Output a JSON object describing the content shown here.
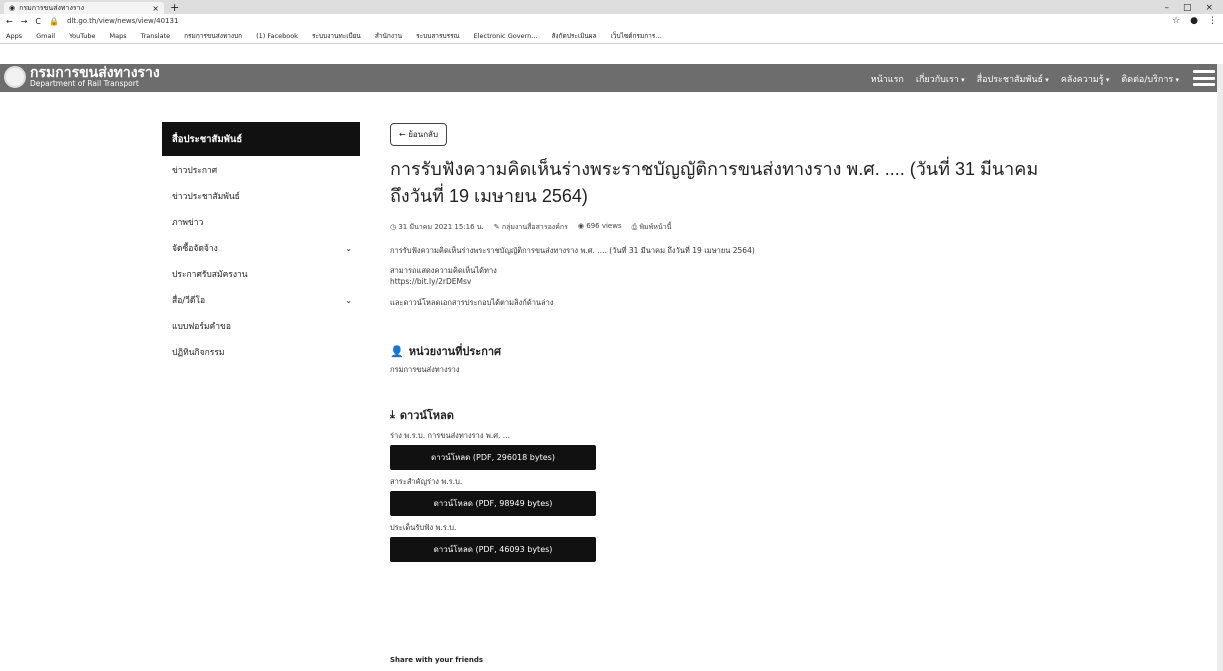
{
  "browser": {
    "tab_title": "กรมการขนส่งทางราง",
    "url": "dlt.go.th/view/news/view/40131",
    "bookmarks": [
      "Apps",
      "Gmail",
      "YouTube",
      "Maps",
      "Translate",
      "กรมการขนส่งทางบก",
      "(1) Facebook",
      "ระบบงานทะเบียน",
      "สำนักงาน",
      "ระบบสารบรรณ",
      "Electronic Govern...",
      "สังกัดประเมินผล",
      "เว็บไซต์กรมการ..."
    ]
  },
  "header": {
    "logo_th": "กรมการขนส่งทางราง",
    "logo_en": "Department of Rail Transport",
    "nav": [
      "หน้าแรก",
      "เกี่ยวกับเรา",
      "สื่อประชาสัมพันธ์",
      "คลังความรู้",
      "ติดต่อ/บริการ"
    ]
  },
  "sidebar": {
    "heading": "สื่อประชาสัมพันธ์",
    "items": [
      {
        "label": "ข่าวประกาศ",
        "chevron": false
      },
      {
        "label": "ข่าวประชาสัมพันธ์",
        "chevron": false
      },
      {
        "label": "ภาพข่าว",
        "chevron": false
      },
      {
        "label": "จัดซื้อจัดจ้าง",
        "chevron": true
      },
      {
        "label": "ประกาศรับสมัครงาน",
        "chevron": false
      },
      {
        "label": "สื่อ/วีดีโอ",
        "chevron": true
      },
      {
        "label": "แบบฟอร์มคำขอ",
        "chevron": false
      },
      {
        "label": "ปฏิทินกิจกรรม",
        "chevron": false
      }
    ]
  },
  "main": {
    "back_label": "← ย้อนกลับ",
    "title": "การรับฟังความคิดเห็นร่างพระราชบัญญัติการขนส่งทางราง พ.ศ. .... (วันที่ 31 มีนาคม ถึงวันที่ 19 เมษายน 2564)",
    "meta": {
      "date": "31 มีนาคม 2021 15:16 น.",
      "author": "กลุ่มงานสื่อสารองค์กร",
      "views": "696 views",
      "print": "พิมพ์หน้านี้"
    },
    "summary": "การรับฟังความคิดเห็นร่างพระราชบัญญัติการขนส่งทางราง พ.ศ. .... (วันที่ 31 มีนาคม ถึงวันที่ 19 เมษายน 2564)",
    "comment_line1": "สามารถแสดงความคิดเห็นได้ทาง",
    "comment_link": "https://bit.ly/2rDEMsv",
    "download_note": "และดาวน์โหลดเอกสารประกอบได้ตามลิงก์ด้านล่าง",
    "agency_heading": "หน่วยงานที่ประกาศ",
    "agency_name": "กรมการขนส่งทางราง",
    "download_heading": "ดาวน์โหลด",
    "files": [
      {
        "label": "ร่าง พ.ร.บ. การขนส่งทางราง พ.ศ. ...",
        "button": "ดาวน์โหลด (PDF, 296018 bytes)"
      },
      {
        "label": "สาระสำคัญร่าง พ.ร.บ.",
        "button": "ดาวน์โหลด (PDF, 98949 bytes)"
      },
      {
        "label": "ประเด็นรับฟัง พ.ร.บ.",
        "button": "ดาวน์โหลด (PDF, 46093 bytes)"
      }
    ],
    "share": "Share with your friends"
  }
}
